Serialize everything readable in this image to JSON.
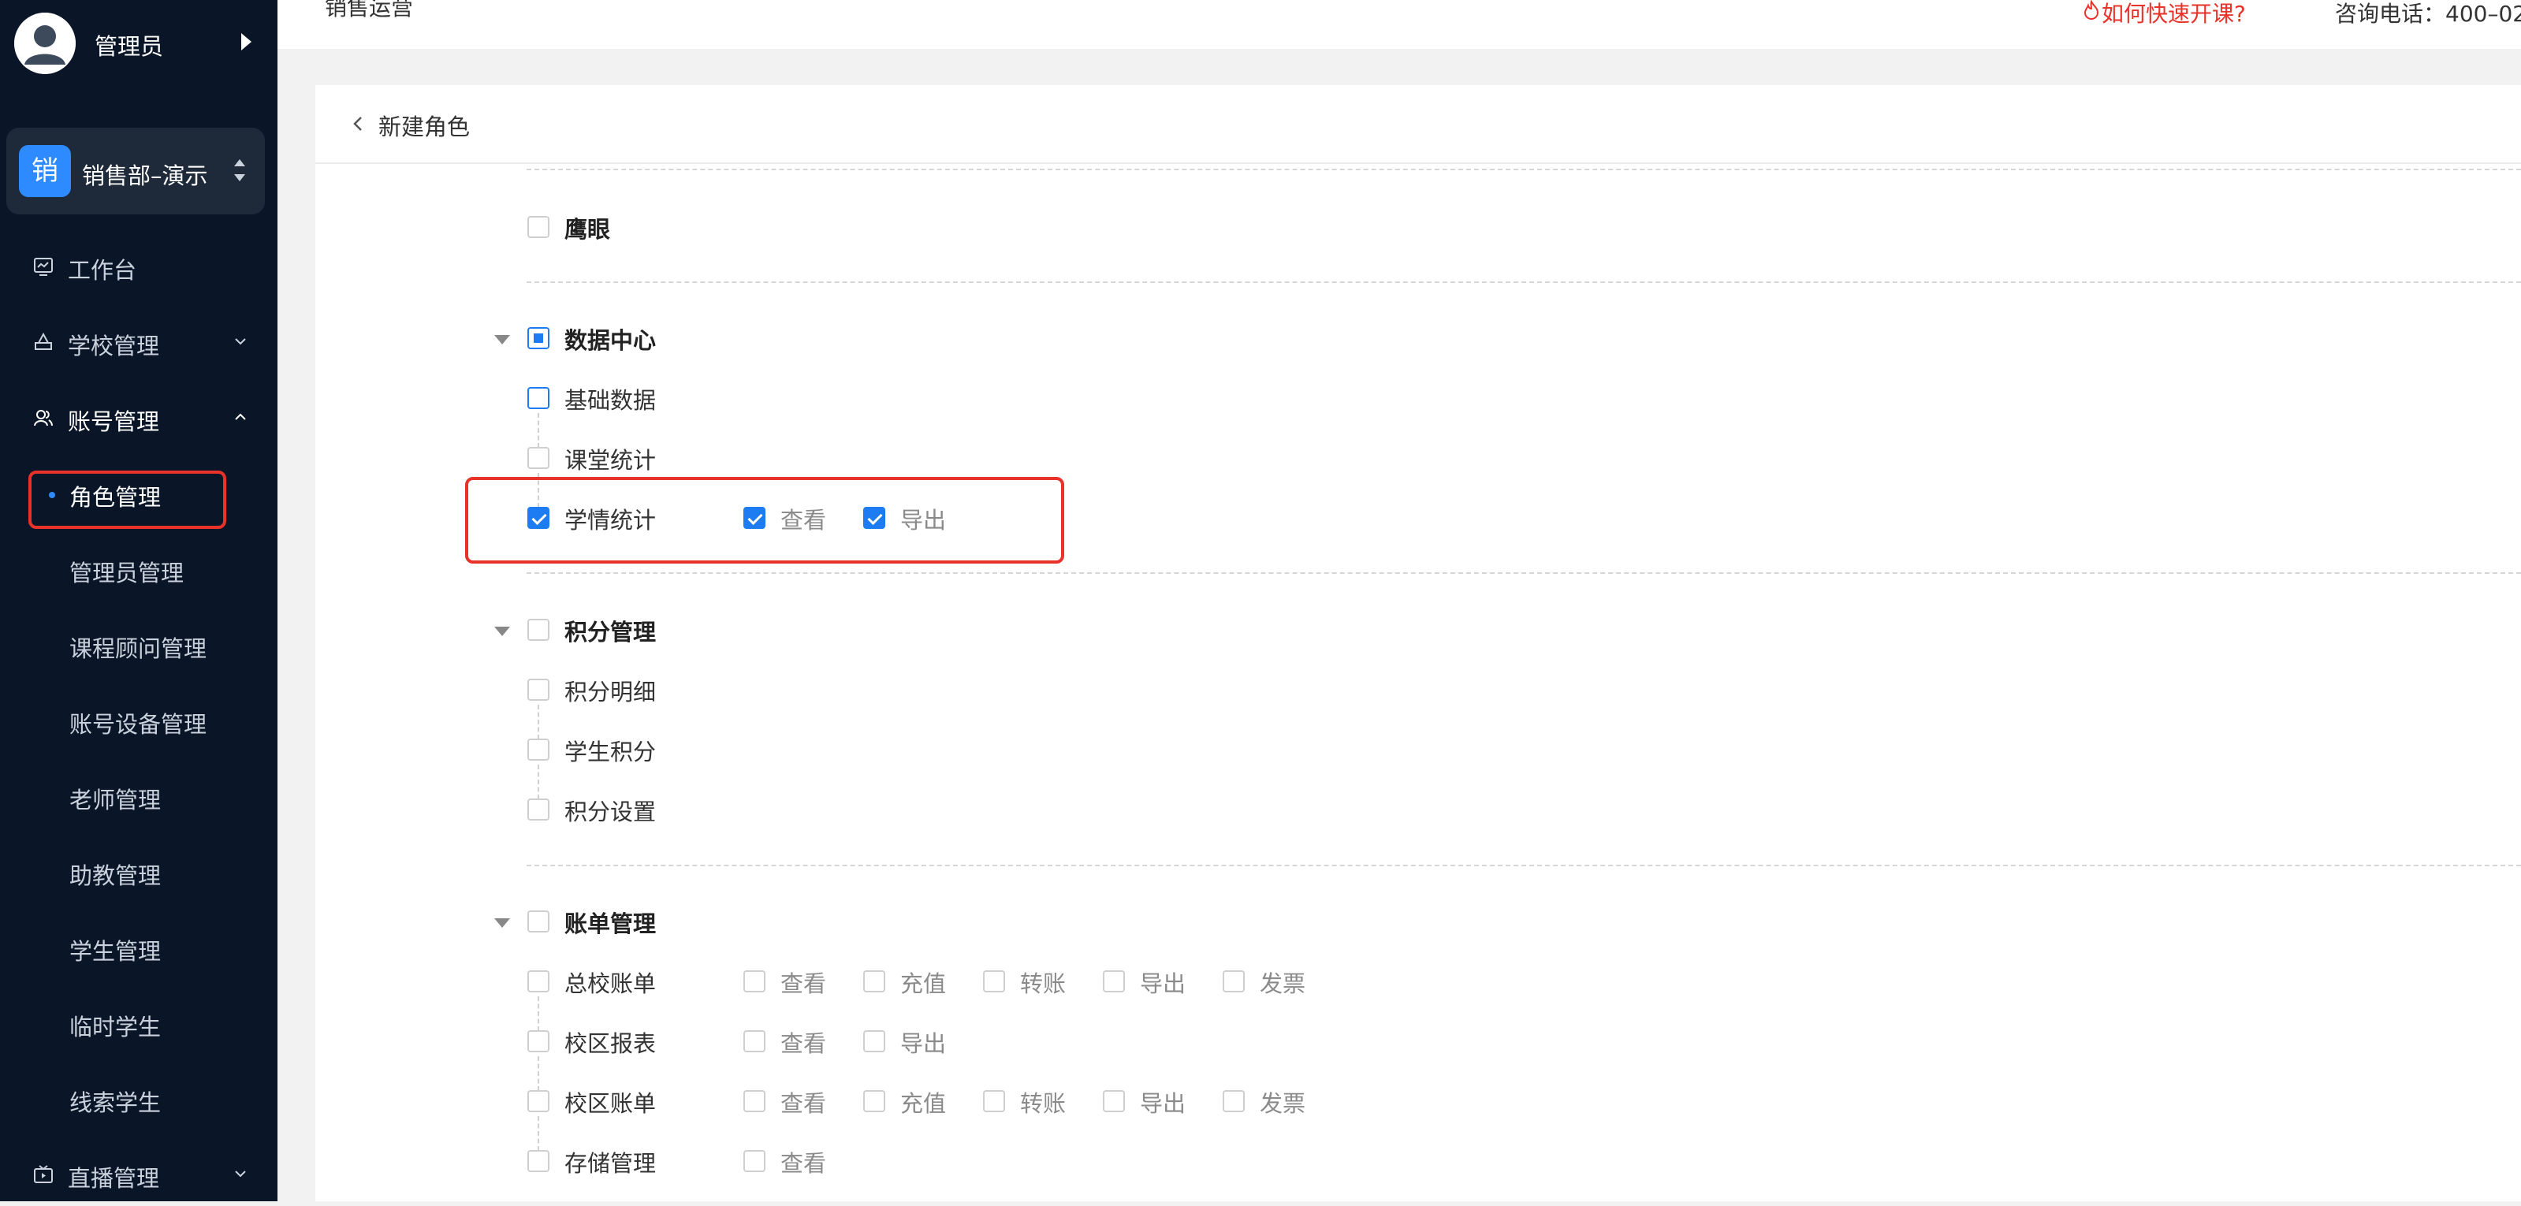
{
  "user": {
    "name": "管理员"
  },
  "org": {
    "badge": "销",
    "name": "销售部–演示"
  },
  "nav": {
    "workbench": "工作台",
    "school": "学校管理",
    "account": "账号管理",
    "live": "直播管理",
    "account_sub": [
      "角色管理",
      "管理员管理",
      "课程顾问管理",
      "账号设备管理",
      "老师管理",
      "助教管理",
      "学生管理",
      "临时学生",
      "线索学生"
    ]
  },
  "topbar": {
    "title": "销售运营",
    "help_link": "如何快速开课?",
    "phone": "咨询电话：400–02"
  },
  "page": {
    "title": "新建角色"
  },
  "permissions": {
    "eagle_eye": "鹰眼",
    "data_center": {
      "label": "数据中心",
      "items": [
        "基础数据",
        "课堂统计",
        "学情统计"
      ],
      "learning_actions": [
        "查看",
        "导出"
      ]
    },
    "points": {
      "label": "积分管理",
      "items": [
        "积分明细",
        "学生积分",
        "积分设置"
      ]
    },
    "billing": {
      "label": "账单管理",
      "rows": [
        {
          "label": "总校账单",
          "actions": [
            "查看",
            "充值",
            "转账",
            "导出",
            "发票"
          ]
        },
        {
          "label": "校区报表",
          "actions": [
            "查看",
            "导出"
          ]
        },
        {
          "label": "校区账单",
          "actions": [
            "查看",
            "充值",
            "转账",
            "导出",
            "发票"
          ]
        },
        {
          "label": "存储管理",
          "actions": [
            "查看"
          ]
        }
      ]
    }
  },
  "colors": {
    "accent": "#1d7cf2",
    "sidebar_bg": "#0a1628",
    "annotation": "#e8322a"
  },
  "icons": [
    "user-avatar-icon",
    "caret-right-icon",
    "sort-icon",
    "monitor-icon",
    "school-icon",
    "users-icon",
    "live-icon",
    "chevron-down-icon",
    "chevron-up-icon",
    "chevron-left-icon",
    "fire-icon",
    "caret-down-icon"
  ]
}
